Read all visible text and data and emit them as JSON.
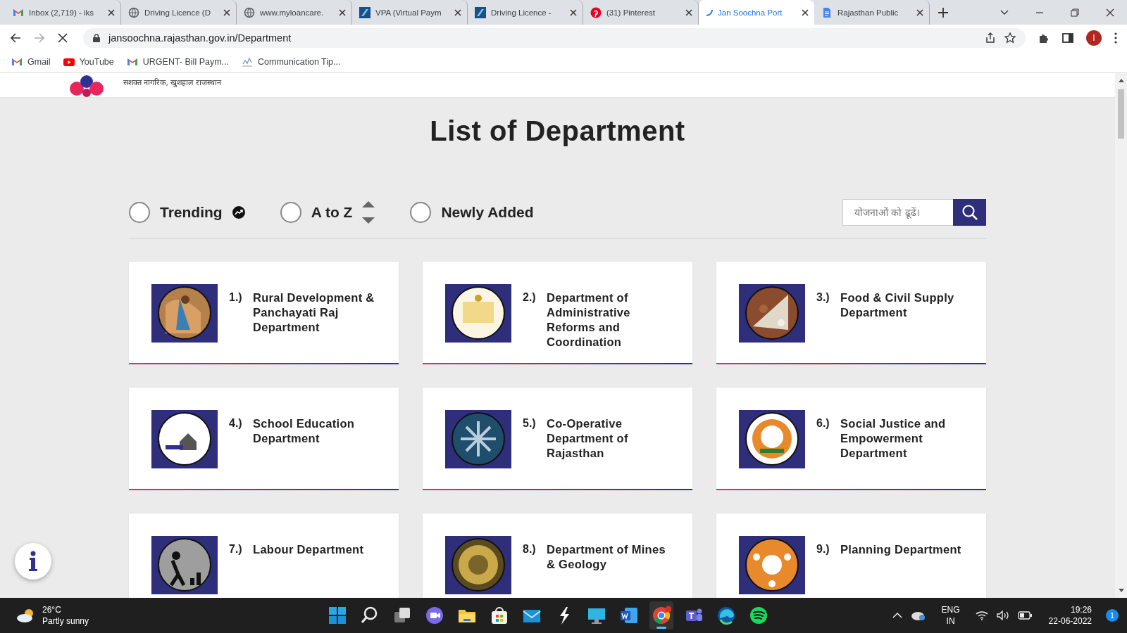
{
  "browser": {
    "tabs": [
      {
        "title": "Inbox (2,719) - iks",
        "kind": "gmail",
        "selected": false
      },
      {
        "title": "Driving Licence (D",
        "kind": "globe",
        "selected": false
      },
      {
        "title": "www.myloancare.",
        "kind": "globe",
        "selected": false
      },
      {
        "title": "VPA (Virtual Paym",
        "kind": "vpa",
        "selected": false
      },
      {
        "title": "Driving Licence -",
        "kind": "vpa",
        "selected": false
      },
      {
        "title": "(31) Pinterest",
        "kind": "pinterest",
        "selected": false
      },
      {
        "title": "Jan Soochna Port",
        "kind": "loading",
        "selected": true
      },
      {
        "title": "Rajasthan Public",
        "kind": "docs",
        "selected": false
      }
    ],
    "address": "jansoochna.rajasthan.gov.in/Department",
    "profile": "I",
    "bookmarks": [
      {
        "label": "Gmail",
        "kind": "gmail"
      },
      {
        "label": "YouTube",
        "kind": "youtube"
      },
      {
        "label": "URGENT- Bill Paym...",
        "kind": "gmail"
      },
      {
        "label": "Communication Tip...",
        "kind": "chart"
      }
    ]
  },
  "page": {
    "tagline": "सशक्त नागरिक, खुशहाल राजस्थान",
    "title": "List of Department",
    "filters": [
      {
        "label": "Trending",
        "kind": "trending",
        "selected": false
      },
      {
        "label": "A to Z",
        "kind": "sort",
        "selected": false
      },
      {
        "label": "Newly Added",
        "kind": "plain",
        "selected": false
      }
    ],
    "search": {
      "placeholder": "योजनाओं को ढूढें।"
    },
    "departments": [
      {
        "number": "1.)",
        "name": "Rural Development & Panchayati Raj Department"
      },
      {
        "number": "2.)",
        "name": "Department of Administrative Reforms and Coordination"
      },
      {
        "number": "3.)",
        "name": "Food & Civil Supply Department"
      },
      {
        "number": "4.)",
        "name": "School Education Department"
      },
      {
        "number": "5.)",
        "name": "Co-Operative Department of Rajasthan"
      },
      {
        "number": "6.)",
        "name": "Social Justice and Empowerment Department"
      },
      {
        "number": "7.)",
        "name": "Labour Department"
      },
      {
        "number": "8.)",
        "name": "Department of Mines & Geology"
      },
      {
        "number": "9.)",
        "name": "Planning Department"
      }
    ]
  },
  "taskbar": {
    "weather": {
      "temperature": "26°C",
      "condition": "Partly sunny"
    },
    "apps": [
      {
        "kind": "start",
        "active": false
      },
      {
        "kind": "search",
        "active": false
      },
      {
        "kind": "taskview",
        "active": false
      },
      {
        "kind": "meet",
        "active": false
      },
      {
        "kind": "folder",
        "active": false
      },
      {
        "kind": "store",
        "active": false
      },
      {
        "kind": "mail",
        "active": false
      },
      {
        "kind": "bolt",
        "active": false
      },
      {
        "kind": "monitor",
        "active": false
      },
      {
        "kind": "word",
        "active": false
      },
      {
        "kind": "chrome",
        "active": true
      },
      {
        "kind": "teams",
        "active": false
      },
      {
        "kind": "edge",
        "active": false
      },
      {
        "kind": "spotify",
        "active": false
      }
    ],
    "language": "ENG",
    "region": "IN",
    "time": "19:26",
    "date": "22-06-2022",
    "notifications": "1"
  }
}
